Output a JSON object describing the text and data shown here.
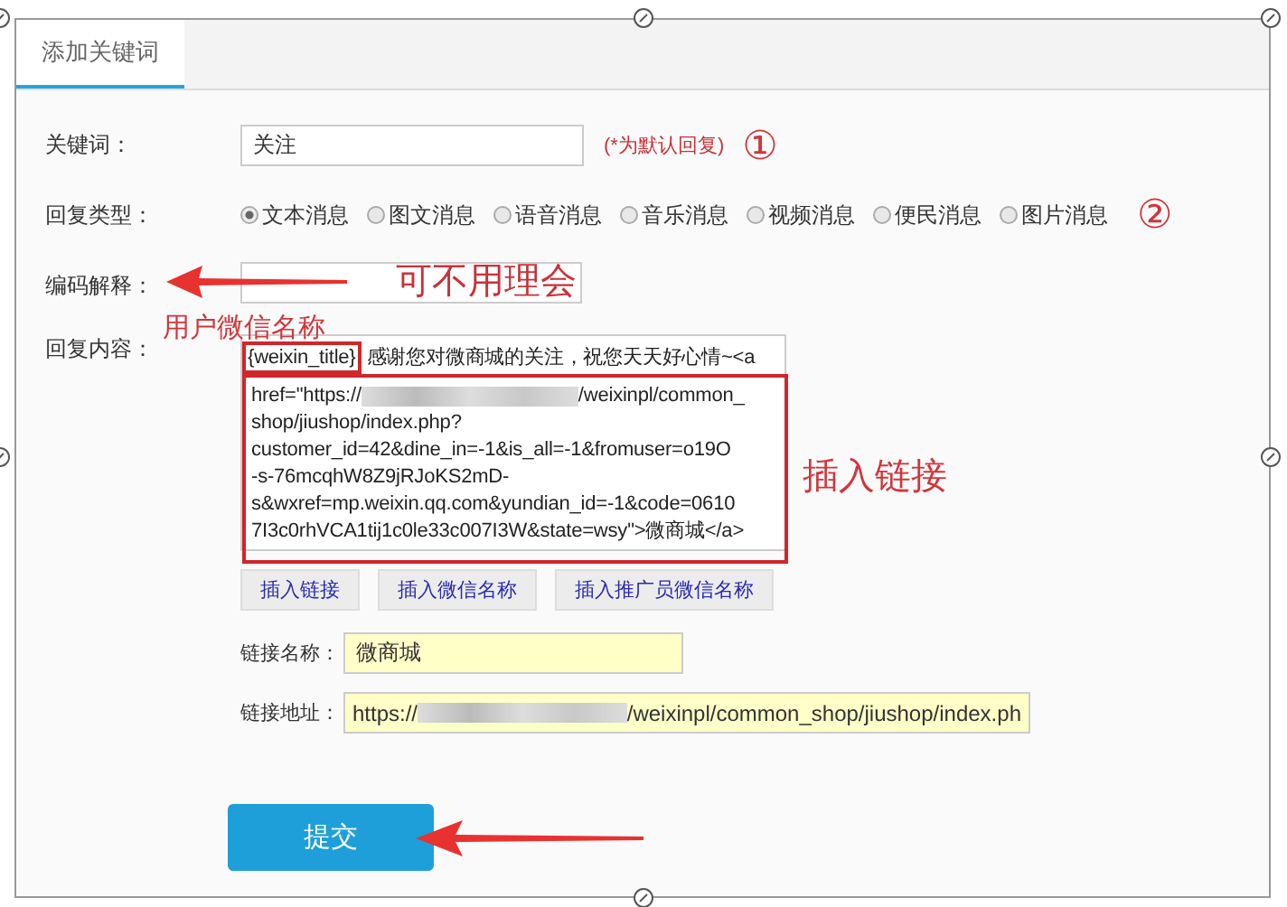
{
  "tabs": [
    {
      "label": "添加关键词",
      "selected": true
    }
  ],
  "keyword": {
    "label": "关键词：",
    "value": "关注",
    "hint": "(*为默认回复)",
    "marker": "①"
  },
  "reply_type": {
    "label": "回复类型：",
    "marker": "②",
    "options": [
      {
        "label": "文本消息",
        "selected": true
      },
      {
        "label": "图文消息",
        "selected": false
      },
      {
        "label": "语音消息",
        "selected": false
      },
      {
        "label": "音乐消息",
        "selected": false
      },
      {
        "label": "视频消息",
        "selected": false
      },
      {
        "label": "便民消息",
        "selected": false
      },
      {
        "label": "图片消息",
        "selected": false
      }
    ]
  },
  "encoding": {
    "label": "编码解释："
  },
  "reply_content": {
    "label": "回复内容：",
    "highlighted_token": "{weixin_title}",
    "lines": [
      [
        "感谢您对微商城的关注，祝您天天好心情~<a"
      ],
      [
        "href=\"https://",
        "/weixinpl/common_"
      ],
      [
        "shop/jiushop/index.php?"
      ],
      [
        "customer_id=42&dine_in=-1&is_all=-1&fromuser=o19O"
      ],
      [
        "-s-76mcqhW8Z9jRJoKS2mD-"
      ],
      [
        "s&wxref=mp.weixin.qq.com&yundian_id=-1&code=0610"
      ],
      [
        "7I3c0rhVCA1tij1c0le33c007I3W&state=wsy\">微商城</a>"
      ]
    ]
  },
  "insert_buttons": [
    "插入链接",
    "插入微信名称",
    "插入推广员微信名称"
  ],
  "link_name": {
    "label": "链接名称：",
    "value": "微商城"
  },
  "link_address": {
    "label": "链接地址：",
    "value_start": "https://",
    "value_end": "/weixinpl/common_shop/jiushop/index.ph"
  },
  "submit": "提交",
  "annotations": {
    "ignore_note": "可不用理会",
    "name_note": "用户微信名称",
    "link_note": "插入链接"
  }
}
